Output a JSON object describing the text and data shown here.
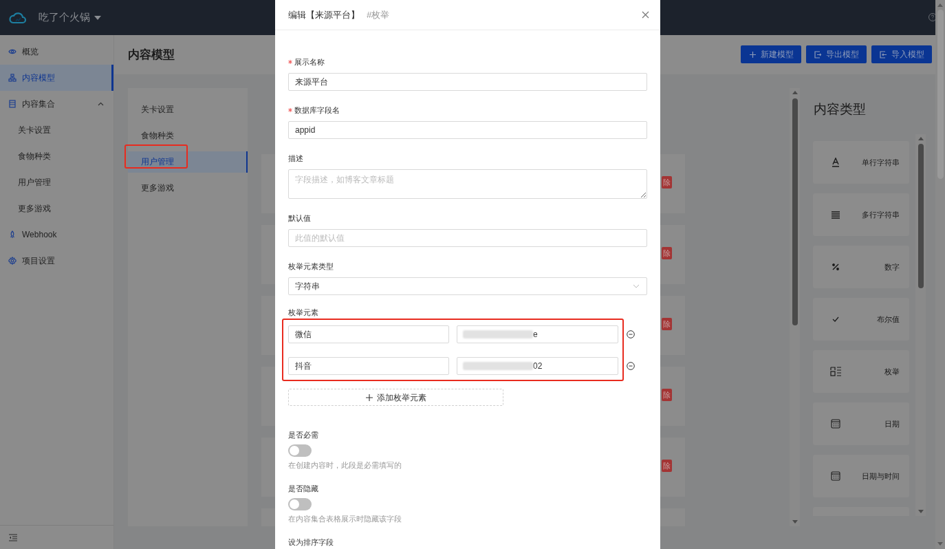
{
  "header": {
    "project": "吃了个火锅"
  },
  "sidebar": {
    "items": [
      {
        "label": "概览",
        "selected": false
      },
      {
        "label": "内容模型",
        "selected": true
      },
      {
        "label": "内容集合",
        "selected": false,
        "expanded": true,
        "children": [
          {
            "label": "关卡设置",
            "selected": false
          },
          {
            "label": "食物种类",
            "selected": false
          },
          {
            "label": "用户管理",
            "selected": false
          },
          {
            "label": "更多游戏",
            "selected": false
          }
        ]
      },
      {
        "label": "Webhook",
        "selected": false
      },
      {
        "label": "项目设置",
        "selected": false
      }
    ]
  },
  "page_title": "内容模型",
  "actions": [
    {
      "label": "新建模型"
    },
    {
      "label": "导出模型"
    },
    {
      "label": "导入模型"
    }
  ],
  "model_list": [
    {
      "label": "关卡设置",
      "selected": false
    },
    {
      "label": "食物种类",
      "selected": false
    },
    {
      "label": "用户管理",
      "selected": true
    },
    {
      "label": "更多游戏",
      "selected": false
    }
  ],
  "model_cards": [
    {
      "badge": "除"
    },
    {
      "badge": "除"
    },
    {
      "badge": "除"
    },
    {
      "badge": "除"
    },
    {
      "badge": "除"
    }
  ],
  "content_types": {
    "title": "内容类型",
    "items": [
      {
        "label": "单行字符串"
      },
      {
        "label": "多行字符串"
      },
      {
        "label": "数字"
      },
      {
        "label": "布尔值"
      },
      {
        "label": "枚举"
      },
      {
        "label": "日期"
      },
      {
        "label": "日期与时间"
      }
    ]
  },
  "modal": {
    "title": "编辑【来源平台】",
    "tag": "#枚举",
    "fields": [
      {
        "kind": "text",
        "label": "展示名称",
        "required": true,
        "value": "来源平台"
      },
      {
        "kind": "text",
        "label": "数据库字段名",
        "required": true,
        "value": "appid"
      },
      {
        "kind": "textarea",
        "label": "描述",
        "required": false,
        "placeholder": "字段描述，如博客文章标题"
      },
      {
        "kind": "text",
        "label": "默认值",
        "required": false,
        "placeholder": "此值的默认值"
      },
      {
        "kind": "select",
        "label": "枚举元素类型",
        "required": false,
        "value": "字符串"
      },
      {
        "kind": "enum",
        "label": "枚举元素",
        "required": false,
        "items": [
          {
            "name": "微信",
            "value": "e"
          },
          {
            "name": "抖音",
            "value": "02"
          }
        ],
        "add_label": "添加枚举元素"
      },
      {
        "kind": "switch",
        "label": "是否必需",
        "required": false,
        "on": false,
        "help": "在创建内容时，此段是必需填写的"
      },
      {
        "kind": "switch",
        "label": "是否隐藏",
        "required": false,
        "on": false,
        "help": "在内容集合表格展示时隐藏该字段"
      },
      {
        "kind": "label",
        "label": "设为排序字段",
        "required": false
      }
    ]
  }
}
